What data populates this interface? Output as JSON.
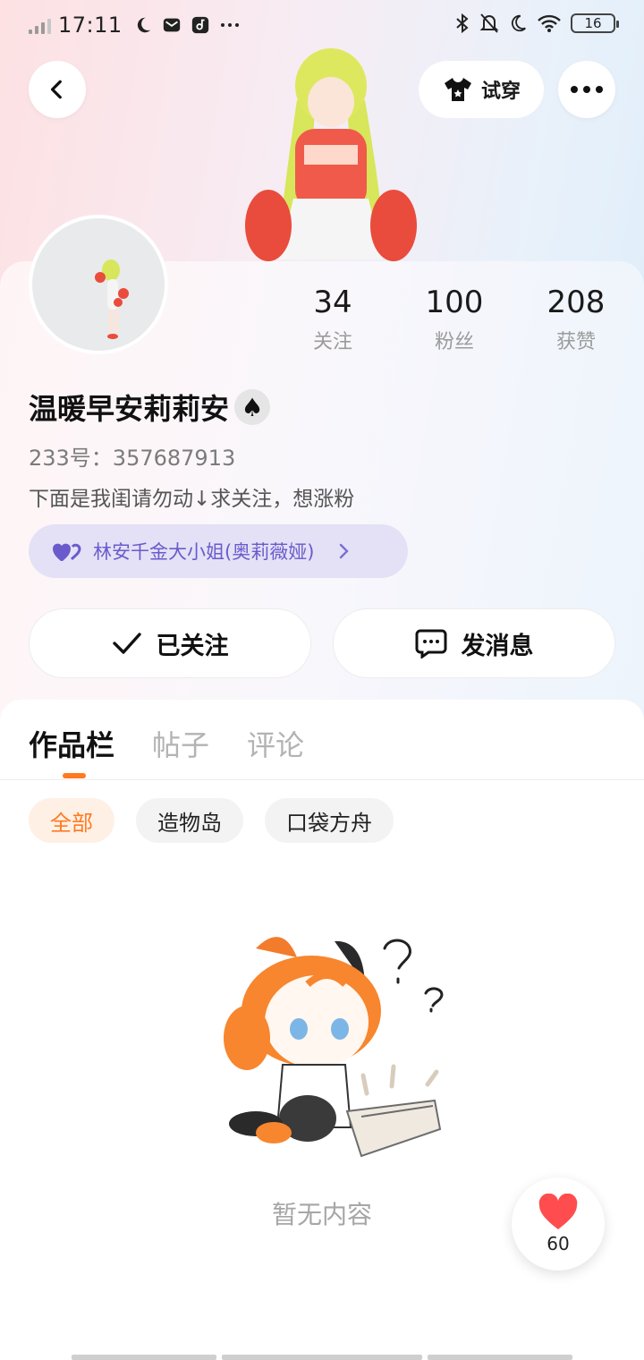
{
  "status_bar": {
    "time": "17:11",
    "battery": "16"
  },
  "header": {
    "tryon_label": "试穿"
  },
  "profile": {
    "stats": [
      {
        "value": "34",
        "label": "关注"
      },
      {
        "value": "100",
        "label": "粉丝"
      },
      {
        "value": "208",
        "label": "获赞"
      }
    ],
    "username": "温暖早安莉莉安",
    "username_suit": "♠",
    "user_id": "233号：357687913",
    "bio": "下面是我闺请勿动↓求关注，想涨粉",
    "tag": "林安千金大小姐(奥莉薇娅)"
  },
  "actions": {
    "followed_label": "已关注",
    "message_label": "发消息"
  },
  "tabs": [
    "作品栏",
    "帖子",
    "评论"
  ],
  "active_tab": "作品栏",
  "chips": [
    "全部",
    "造物岛",
    "口袋方舟"
  ],
  "empty": {
    "text": "暂无内容"
  },
  "like_fab": {
    "count": "60"
  },
  "colors": {
    "accent": "#ff7a1f",
    "tag_purple": "#6a5bcc",
    "heart_red": "#ff4d4f"
  }
}
